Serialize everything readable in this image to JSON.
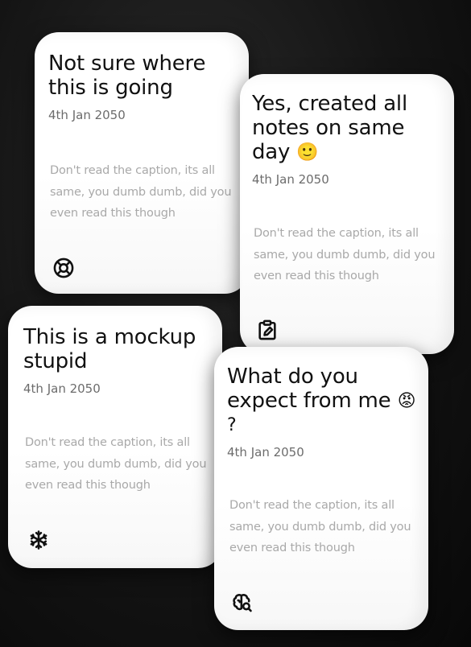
{
  "notes": [
    {
      "title": "Not sure where this is going",
      "emoji": "",
      "date": "4th Jan 2050",
      "body": "Don't read the caption, its all same, you dumb dumb, did you even read this though",
      "icon": "lifebuoy-icon"
    },
    {
      "title": "Yes, created all notes on same day",
      "emoji": "🙂",
      "date": "4th Jan 2050",
      "body": "Don't read the caption, its all same, you dumb dumb, did you even read this though",
      "icon": "clipboard-edit-icon"
    },
    {
      "title": "This is a mockup stupid",
      "emoji": "",
      "date": "4th Jan 2050",
      "body": "Don't read the caption, its all same, you dumb dumb, did you even read this though",
      "icon": "snowflake-icon"
    },
    {
      "title": "What do you expect from me",
      "emoji": "😡 ?",
      "date": "4th Jan 2050",
      "body": "Don't read the caption, its all same, you dumb dumb, did you even read this though",
      "icon": "brain-search-icon"
    }
  ],
  "colors": {
    "card_background": "#ffffff",
    "title": "#111111",
    "date": "#6c6c6c",
    "body": "#a9a9a9",
    "page_background": "#141414"
  }
}
